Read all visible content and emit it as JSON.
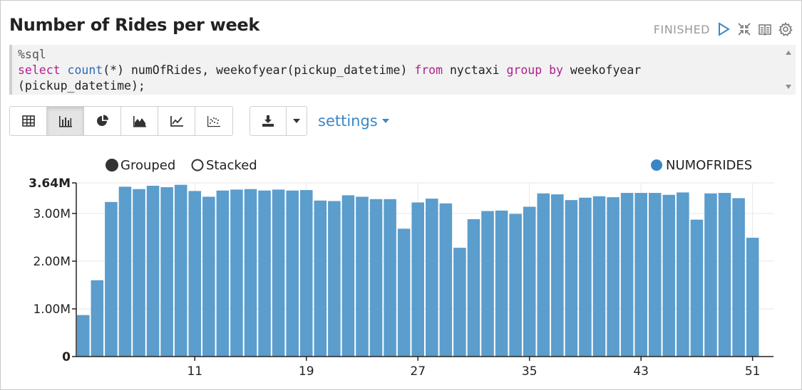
{
  "paragraph": {
    "title": "Number of Rides per week",
    "status": "FINISHED",
    "header_icons": [
      "play-icon",
      "collapse-icon",
      "book-icon",
      "gear-icon"
    ]
  },
  "editor": {
    "line1": "%sql",
    "line2_kw1": "select",
    "line2_fn1": " count",
    "line2_a": "(*) numOfRides, weekofyear(pickup_datetime) ",
    "line2_kw2": "from",
    "line2_b": " nyctaxi ",
    "line2_kw3": "group",
    "line2_c": " ",
    "line2_kw4": "by",
    "line2_d": " weekofyear",
    "line3": "(pickup_datetime);"
  },
  "toolbar": {
    "chart_types": [
      "table-icon",
      "bar-chart-icon",
      "pie-chart-icon",
      "area-chart-icon",
      "line-chart-icon",
      "scatter-chart-icon"
    ],
    "active_chart": "bar-chart-icon",
    "download_icon": "download-icon",
    "settings_label": "settings"
  },
  "chart_data": {
    "type": "bar",
    "mode_options": [
      "Grouped",
      "Stacked"
    ],
    "selected_mode": "Grouped",
    "legend": [
      {
        "name": "NUMOFRIDES",
        "color": "#3a86c4"
      }
    ],
    "bar_color": "#5b9dcc",
    "x_start": 3,
    "x": [
      3,
      4,
      5,
      6,
      7,
      8,
      9,
      10,
      11,
      12,
      13,
      14,
      15,
      16,
      17,
      18,
      19,
      20,
      21,
      22,
      23,
      24,
      25,
      26,
      27,
      28,
      29,
      30,
      31,
      32,
      33,
      34,
      35,
      36,
      37,
      38,
      39,
      40,
      41,
      42,
      43,
      44,
      45,
      46,
      47,
      48,
      49,
      50,
      51,
      52
    ],
    "values": [
      0.87,
      1.6,
      3.24,
      3.56,
      3.51,
      3.58,
      3.55,
      3.6,
      3.47,
      3.35,
      3.48,
      3.5,
      3.51,
      3.48,
      3.5,
      3.48,
      3.49,
      3.27,
      3.26,
      3.38,
      3.35,
      3.3,
      3.3,
      2.68,
      3.23,
      3.31,
      3.21,
      2.28,
      2.88,
      3.05,
      3.06,
      2.99,
      3.14,
      3.42,
      3.4,
      3.28,
      3.33,
      3.36,
      3.34,
      3.43,
      3.43,
      3.43,
      3.39,
      3.44,
      2.87,
      3.42,
      3.43,
      3.32,
      2.49,
      0
    ],
    "x_ticks": [
      "11",
      "19",
      "27",
      "35",
      "43",
      "51"
    ],
    "x_tick_values": [
      11,
      19,
      27,
      35,
      43,
      51
    ],
    "y_ticks": [
      "0",
      "1.00M",
      "2.00M",
      "3.00M",
      "3.64M"
    ],
    "y_tick_values": [
      0,
      1.0,
      2.0,
      3.0,
      3.64
    ],
    "ylim": [
      0,
      3.64
    ],
    "legend_placement": "top-right"
  }
}
